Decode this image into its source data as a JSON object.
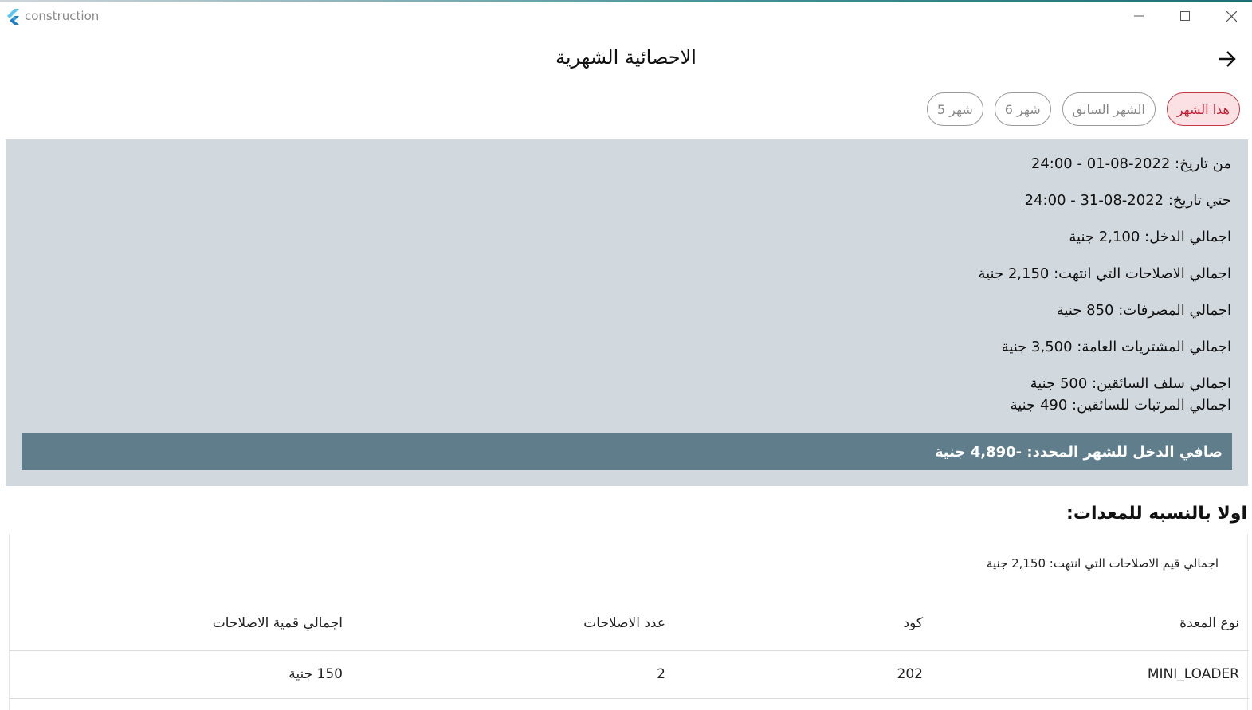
{
  "window": {
    "title": "construction"
  },
  "header": {
    "title": "الاحصائية الشهرية"
  },
  "chips": [
    {
      "label": "هذا الشهر",
      "active": true
    },
    {
      "label": "الشهر السابق",
      "active": false
    },
    {
      "label": "شهر 6",
      "active": false
    },
    {
      "label": "شهر 5",
      "active": false
    }
  ],
  "stats": {
    "from_date": "من تاريخ: 2022-08-01 - 24:00",
    "to_date": "حتي تاريخ: 2022-08-31 - 24:00",
    "total_income": "اجمالي الدخل: 2,100 جنية",
    "total_repairs": "اجمالي الاصلاحات التي انتهت: 2,150 جنية",
    "total_expenses": "اجمالي المصرفات: 850 جنية",
    "total_purchases": "اجمالي المشتريات العامة: 3,500 جنية",
    "driver_advances": "اجمالي سلف السائقين: 500 جنية",
    "driver_salaries": "اجمالي المرتبات للسائقين: 490 جنية",
    "net_income": "صافي الدخل للشهر المحدد: -4,890 جنية"
  },
  "equipment": {
    "section_title": "اولا بالنسبه للمعدات:",
    "summary": "اجمالي قيم الاصلاحات التي انتهت: 2,150 جنية",
    "columns": {
      "type": "نوع المعدة",
      "code": "كود",
      "repairs_count": "عدد الاصلاحات",
      "repairs_total": "اجمالي قمية الاصلاحات"
    },
    "rows": [
      {
        "type": "MINI_LOADER",
        "code": "202",
        "repairs_count": "2",
        "repairs_total": "150 جنية"
      }
    ]
  },
  "colors": {
    "panel_bg": "#d1d8de",
    "net_bar_bg": "#607d8b",
    "chip_active_border": "#c23a46",
    "chip_active_bg": "#fbe1e4"
  }
}
